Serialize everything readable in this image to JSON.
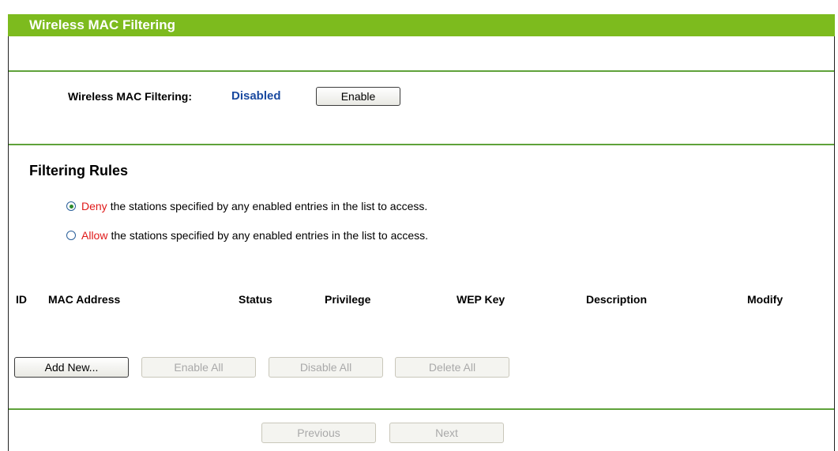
{
  "page_title": "Wireless MAC Filtering",
  "filtering": {
    "label": "Wireless MAC Filtering:",
    "status": "Disabled",
    "enable_button": "Enable"
  },
  "rules": {
    "title": "Filtering Rules",
    "options": [
      {
        "keyword": "Deny",
        "text": "the stations specified by any enabled entries in the list to access.",
        "selected": true
      },
      {
        "keyword": "Allow",
        "text": "the stations specified by any enabled entries in the list to access.",
        "selected": false
      }
    ]
  },
  "table": {
    "headers": [
      "ID",
      "MAC Address",
      "Status",
      "Privilege",
      "WEP Key",
      "Description",
      "Modify"
    ]
  },
  "actions": {
    "add_new": "Add New...",
    "enable_all": "Enable All",
    "disable_all": "Disable All",
    "delete_all": "Delete All"
  },
  "pager": {
    "previous": "Previous",
    "next": "Next"
  },
  "colors": {
    "header_green": "#7dbb1e",
    "divider_green": "#5fa23a",
    "status_blue": "#1a4aa0",
    "keyword_red": "#e01818"
  }
}
